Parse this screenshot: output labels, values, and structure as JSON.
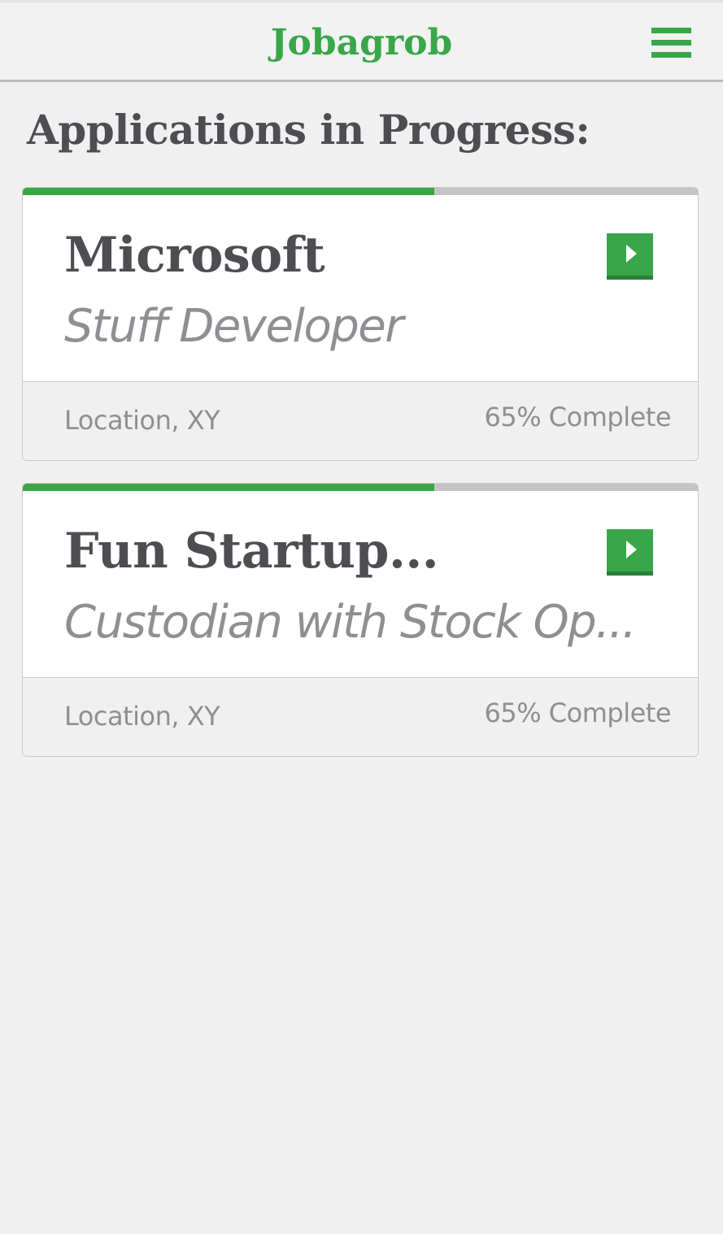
{
  "app": {
    "title": "Jobagrob",
    "accent_color": "#3aa64a"
  },
  "header": {
    "menu_icon": "hamburger-menu-icon"
  },
  "main": {
    "heading": "Applications in Progress:",
    "applications": [
      {
        "company": "Microsoft",
        "role": "Stuff Developer",
        "location": "Location, XY",
        "completion_label": "65% Complete",
        "progress": 0.61,
        "action_icon": "play-arrow-icon"
      },
      {
        "company": "Fun Startup...",
        "role": "Custodian with Stock Op...",
        "location": "Location, XY",
        "completion_label": "65% Complete",
        "progress": 0.61,
        "action_icon": "play-arrow-icon"
      }
    ]
  }
}
